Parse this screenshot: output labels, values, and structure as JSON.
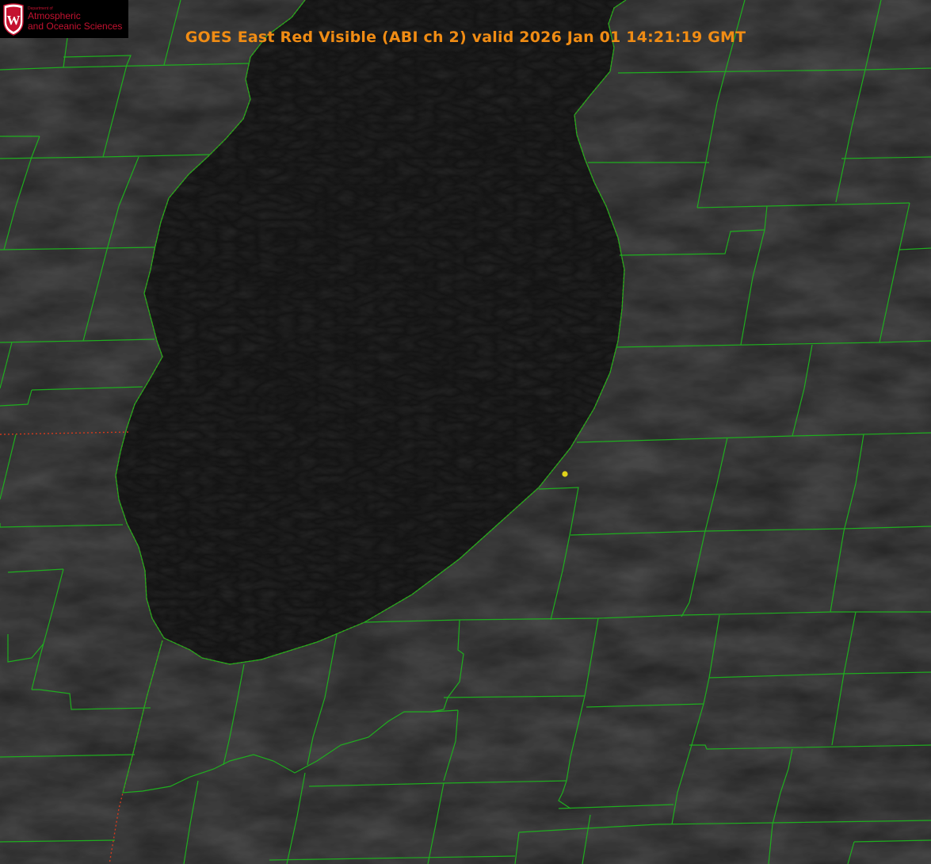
{
  "title": "GOES East Red Visible (ABI ch 2) valid 2026 Jan 01 14:21:19 GMT",
  "logo": {
    "department_line": "Department of",
    "line1": "Atmospheric",
    "line2": "and Oceanic Sciences",
    "shield_letter": "W"
  },
  "colors": {
    "title": "#f08c14",
    "county_lines": "#1fae1f",
    "state_border": "#d33a1d",
    "lake_fill": "#121212",
    "land_fill": "#262626",
    "marker": "#e0d21a",
    "logo_red": "#c41230"
  },
  "icons": [
    "location-marker-icon",
    "uw-shield-icon"
  ]
}
